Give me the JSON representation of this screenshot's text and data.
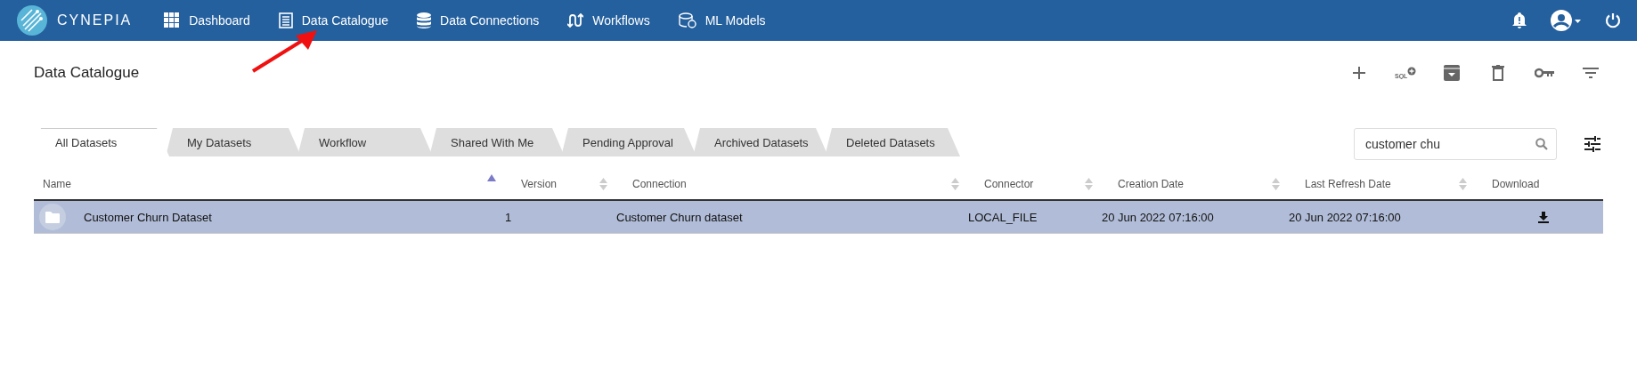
{
  "brand": "CYNEPIA",
  "nav": [
    {
      "label": "Dashboard"
    },
    {
      "label": "Data Catalogue"
    },
    {
      "label": "Data Connections"
    },
    {
      "label": "Workflows"
    },
    {
      "label": "ML Models"
    }
  ],
  "page_title": "Data Catalogue",
  "toolbar": [
    {
      "kind": "add"
    },
    {
      "kind": "sql",
      "label": "SQL"
    },
    {
      "kind": "archive"
    },
    {
      "kind": "delete"
    },
    {
      "kind": "key"
    },
    {
      "kind": "filter"
    }
  ],
  "tabs": [
    {
      "label": "All Datasets",
      "selected": true
    },
    {
      "label": "My Datasets",
      "selected": false
    },
    {
      "label": "Workflow",
      "selected": false
    },
    {
      "label": "Shared With Me",
      "selected": false
    },
    {
      "label": "Pending Approval",
      "selected": false
    },
    {
      "label": "Archived Datasets",
      "selected": false
    },
    {
      "label": "Deleted Datasets",
      "selected": false
    }
  ],
  "search": {
    "value": "customer chu"
  },
  "table": {
    "columns": [
      {
        "label": "Name",
        "kind": "sortable",
        "sorted": true
      },
      {
        "label": "Version",
        "kind": "sortable",
        "sorted": false
      },
      {
        "label": "Connection",
        "kind": "sortable",
        "sorted": false
      },
      {
        "label": "Connector",
        "kind": "sortable",
        "sorted": false
      },
      {
        "label": "Creation Date",
        "kind": "sortable",
        "sorted": false
      },
      {
        "label": "Last Refresh Date",
        "kind": "sortable",
        "sorted": false
      },
      {
        "label": "Download",
        "kind": "plain"
      }
    ],
    "rows": [
      {
        "selected": true,
        "name": "Customer Churn Dataset",
        "version": "1",
        "connection": "Customer Churn dataset",
        "connector": "LOCAL_FILE",
        "creation_date": "20 Jun 2022 07:16:00",
        "last_refresh_date": "20 Jun 2022 07:16:00"
      }
    ]
  }
}
